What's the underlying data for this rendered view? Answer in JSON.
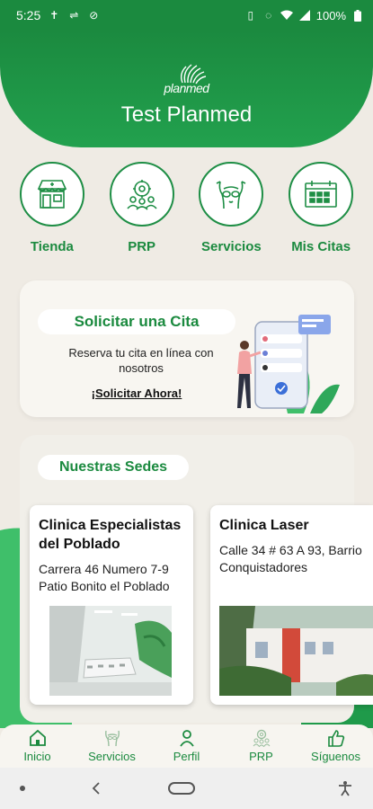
{
  "status_bar": {
    "time": "5:25",
    "battery": "100%"
  },
  "header": {
    "logo_text": "planmed",
    "title": "Test Planmed"
  },
  "quick_nav": [
    {
      "label": "Tienda",
      "icon": "store-icon"
    },
    {
      "label": "PRP",
      "icon": "prp-icon"
    },
    {
      "label": "Servicios",
      "icon": "body-icon"
    },
    {
      "label": "Mis Citas",
      "icon": "calendar-icon"
    }
  ],
  "appointment": {
    "title": "Solicitar una Cita",
    "description": "Reserva tu cita en línea con nosotros",
    "link": "¡Solicitar Ahora!"
  },
  "sedes": {
    "title": "Nuestras Sedes",
    "branches": [
      {
        "name": "Clinica Especialistas del Poblado",
        "address": "Carrera 46 Numero 7-9 Patio Bonito el Poblado"
      },
      {
        "name": "Clinica Laser",
        "address": "Calle 34 # 63 A 93, Barrio Conquistadores"
      }
    ]
  },
  "bottom_nav": [
    {
      "label": "Inicio",
      "icon": "home-icon"
    },
    {
      "label": "Servicios",
      "icon": "services-icon"
    },
    {
      "label": "Perfil",
      "icon": "user-icon"
    },
    {
      "label": "PRP",
      "icon": "prp-icon"
    },
    {
      "label": "Síguenos",
      "icon": "thumbs-up-icon"
    }
  ],
  "colors": {
    "brand": "#1b8a3f",
    "background": "#efebe4"
  }
}
